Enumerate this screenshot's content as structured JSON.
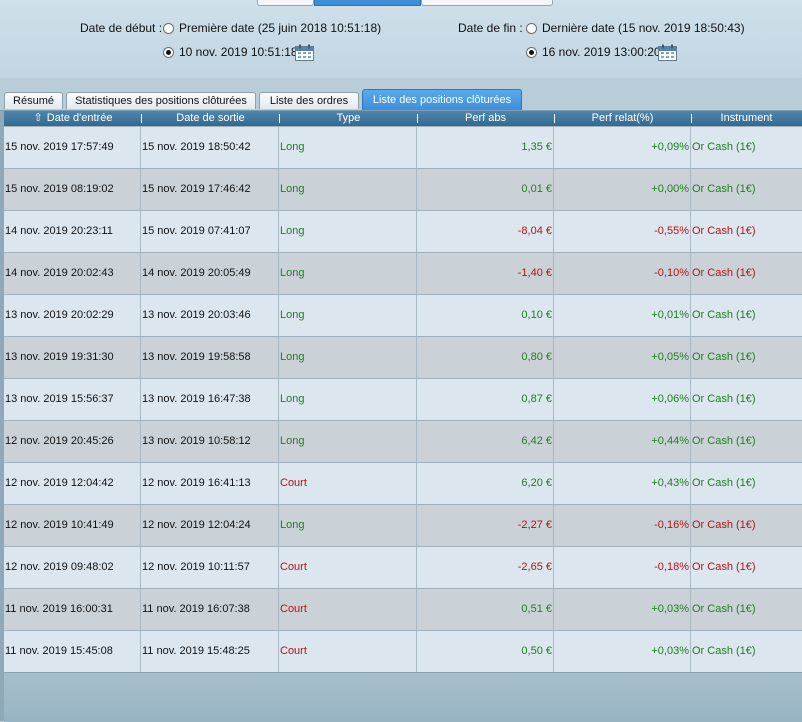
{
  "date_range": {
    "start_label": "Date de début :",
    "start_option_first": "Première date (25 juin 2018 10:51:18)",
    "start_option_custom": "10 nov. 2019 10:51:18",
    "end_label": "Date de fin :",
    "end_option_last": "Dernière date (15 nov. 2019 18:50:43)",
    "end_option_custom": "16 nov. 2019 13:00:20"
  },
  "tabs": [
    {
      "label": "Résumé"
    },
    {
      "label": "Statistiques des positions clôturées"
    },
    {
      "label": "Liste des ordres"
    },
    {
      "label": "Liste des positions clôturées"
    }
  ],
  "table": {
    "columns": [
      "Date d'entrée",
      "Date de sortie",
      "Type",
      "Perf abs",
      "Perf relat(%)",
      "Instrument"
    ],
    "rows": [
      {
        "entry": "15 nov. 2019 17:57:49",
        "exit": "15 nov. 2019 18:50:42",
        "type": "Long",
        "perf_abs": "1,35 €",
        "perf_rel": "+0,09%",
        "instrument": "Or Cash (1€)",
        "positive": true
      },
      {
        "entry": "15 nov. 2019 08:19:02",
        "exit": "15 nov. 2019 17:46:42",
        "type": "Long",
        "perf_abs": "0,01 €",
        "perf_rel": "+0,00%",
        "instrument": "Or Cash (1€)",
        "positive": true
      },
      {
        "entry": "14 nov. 2019 20:23:11",
        "exit": "15 nov. 2019 07:41:07",
        "type": "Long",
        "perf_abs": "-8,04 €",
        "perf_rel": "-0,55%",
        "instrument": "Or Cash (1€)",
        "positive": false
      },
      {
        "entry": "14 nov. 2019 20:02:43",
        "exit": "14 nov. 2019 20:05:49",
        "type": "Long",
        "perf_abs": "-1,40 €",
        "perf_rel": "-0,10%",
        "instrument": "Or Cash (1€)",
        "positive": false
      },
      {
        "entry": "13 nov. 2019 20:02:29",
        "exit": "13 nov. 2019 20:03:46",
        "type": "Long",
        "perf_abs": "0,10 €",
        "perf_rel": "+0,01%",
        "instrument": "Or Cash (1€)",
        "positive": true
      },
      {
        "entry": "13 nov. 2019 19:31:30",
        "exit": "13 nov. 2019 19:58:58",
        "type": "Long",
        "perf_abs": "0,80 €",
        "perf_rel": "+0,05%",
        "instrument": "Or Cash (1€)",
        "positive": true
      },
      {
        "entry": "13 nov. 2019 15:56:37",
        "exit": "13 nov. 2019 16:47:38",
        "type": "Long",
        "perf_abs": "0,87 €",
        "perf_rel": "+0,06%",
        "instrument": "Or Cash (1€)",
        "positive": true
      },
      {
        "entry": "12 nov. 2019 20:45:26",
        "exit": "13 nov. 2019 10:58:12",
        "type": "Long",
        "perf_abs": "6,42 €",
        "perf_rel": "+0,44%",
        "instrument": "Or Cash (1€)",
        "positive": true
      },
      {
        "entry": "12 nov. 2019 12:04:42",
        "exit": "12 nov. 2019 16:41:13",
        "type": "Court",
        "perf_abs": "6,20 €",
        "perf_rel": "+0,43%",
        "instrument": "Or Cash (1€)",
        "positive": true
      },
      {
        "entry": "12 nov. 2019 10:41:49",
        "exit": "12 nov. 2019 12:04:24",
        "type": "Long",
        "perf_abs": "-2,27 €",
        "perf_rel": "-0,16%",
        "instrument": "Or Cash (1€)",
        "positive": false
      },
      {
        "entry": "12 nov. 2019 09:48:02",
        "exit": "12 nov. 2019 10:11:57",
        "type": "Court",
        "perf_abs": "-2,65 €",
        "perf_rel": "-0,18%",
        "instrument": "Or Cash (1€)",
        "positive": false
      },
      {
        "entry": "11 nov. 2019 16:00:31",
        "exit": "11 nov. 2019 16:07:38",
        "type": "Court",
        "perf_abs": "0,51 €",
        "perf_rel": "+0,03%",
        "instrument": "Or Cash (1€)",
        "positive": true
      },
      {
        "entry": "11 nov. 2019 15:45:08",
        "exit": "11 nov. 2019 15:48:25",
        "type": "Court",
        "perf_abs": "0,50 €",
        "perf_rel": "+0,03%",
        "instrument": "Or Cash (1€)",
        "positive": true
      }
    ]
  },
  "colors": {
    "positive": "#1f7f1f",
    "negative": "#b31414",
    "short": "#b31414",
    "active_tab": "#3c8fdc",
    "header": "#3d7299"
  }
}
